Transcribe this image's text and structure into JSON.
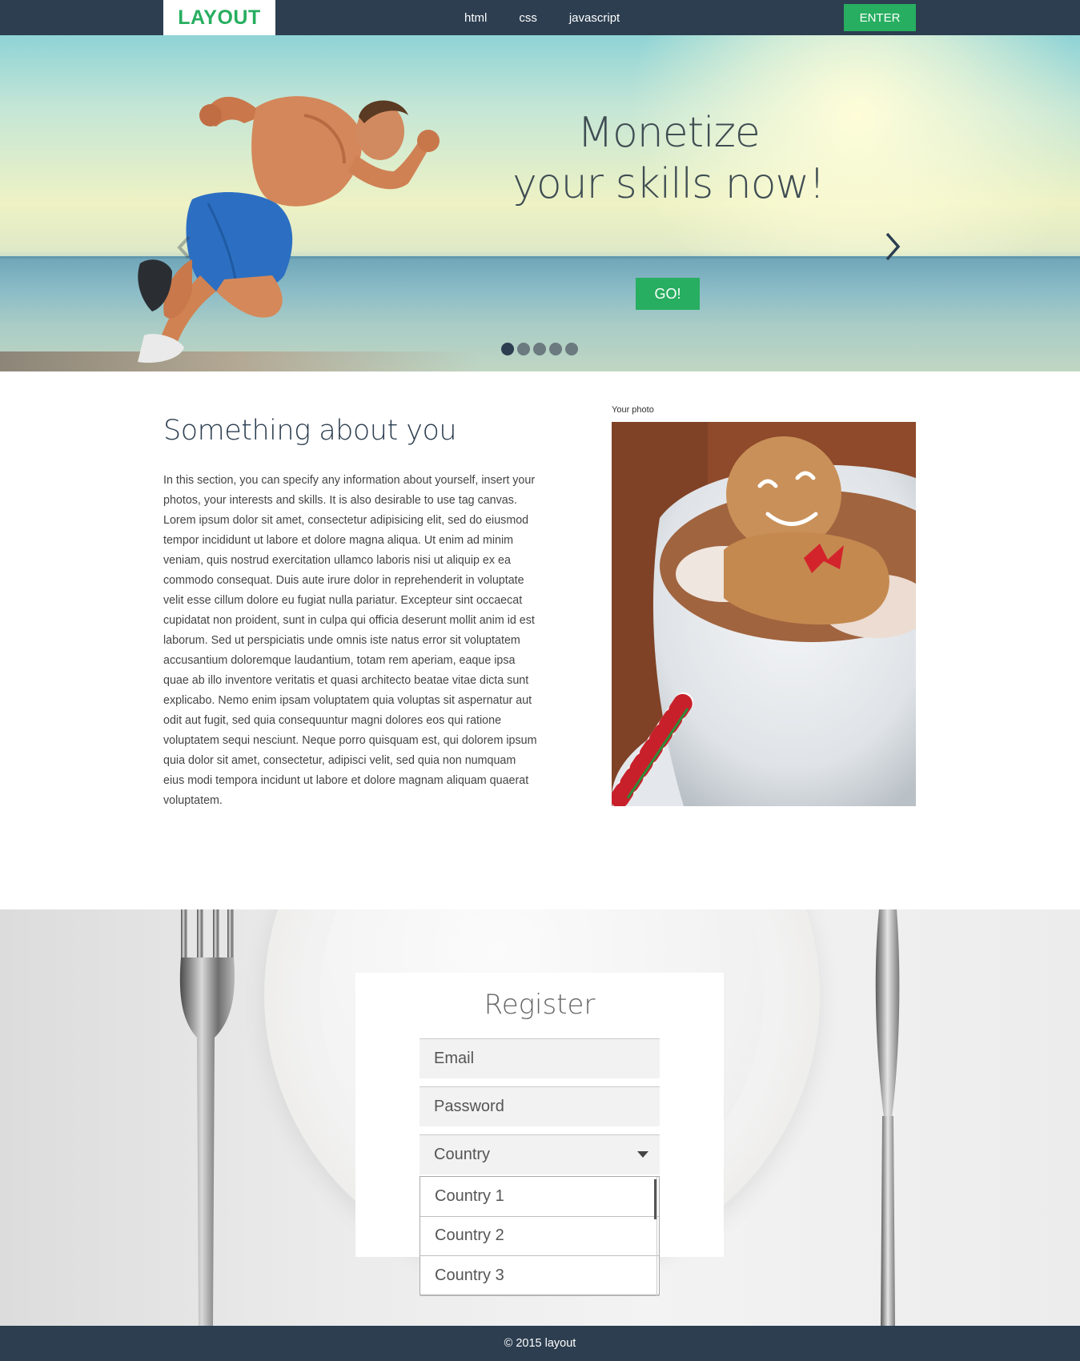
{
  "header": {
    "logo": "LAYOUT",
    "nav": [
      "html",
      "css",
      "javascript"
    ],
    "enter_label": "ENTER"
  },
  "hero": {
    "title_line1": "Monetize",
    "title_line2": "your skills now!",
    "cta_label": "GO!",
    "slides_count": 5,
    "active_slide": 1
  },
  "about": {
    "title": "Something about you",
    "intro": "In this section, you can specify any information about yourself, insert your photos, your interests and skills. It is also desirable to use tag canvas.",
    "body": "Lorem ipsum dolor sit amet, consectetur adipisicing elit, sed do eiusmod tempor incididunt ut labore et dolore magna aliqua. Ut enim ad minim veniam, quis nostrud exercitation ullamco laboris nisi ut aliquip ex ea commodo consequat. Duis aute irure dolor in reprehenderit in voluptate velit esse cillum dolore eu fugiat nulla pariatur. Excepteur sint occaecat cupidatat non proident, sunt in culpa qui officia deserunt mollit anim id est laborum. Sed ut perspiciatis unde omnis iste natus error sit voluptatem accusantium doloremque laudantium, totam rem aperiam, eaque ipsa quae ab illo inventore veritatis et quasi architecto beatae vitae dicta sunt explicabo. Nemo enim ipsam voluptatem quia voluptas sit aspernatur aut odit aut fugit, sed quia consequuntur magni dolores eos qui ratione voluptatem sequi nesciunt. Neque porro quisquam est, qui dolorem ipsum quia dolor sit amet, consectetur, adipisci velit, sed quia non numquam eius modi tempora incidunt ut labore et dolore magnam aliquam quaerat voluptatem.",
    "photo_label": "Your photo"
  },
  "register": {
    "title": "Register",
    "email_placeholder": "Email",
    "password_placeholder": "Password",
    "country_placeholder": "Country",
    "country_options": [
      "Country 1",
      "Country 2",
      "Country 3"
    ]
  },
  "footer": {
    "copyright": "© 2015 layout"
  },
  "colors": {
    "dark": "#2c3e50",
    "accent": "#27ae60"
  },
  "icons": [
    "chevron-right-icon",
    "chevron-left-icon",
    "caret-down-icon"
  ]
}
